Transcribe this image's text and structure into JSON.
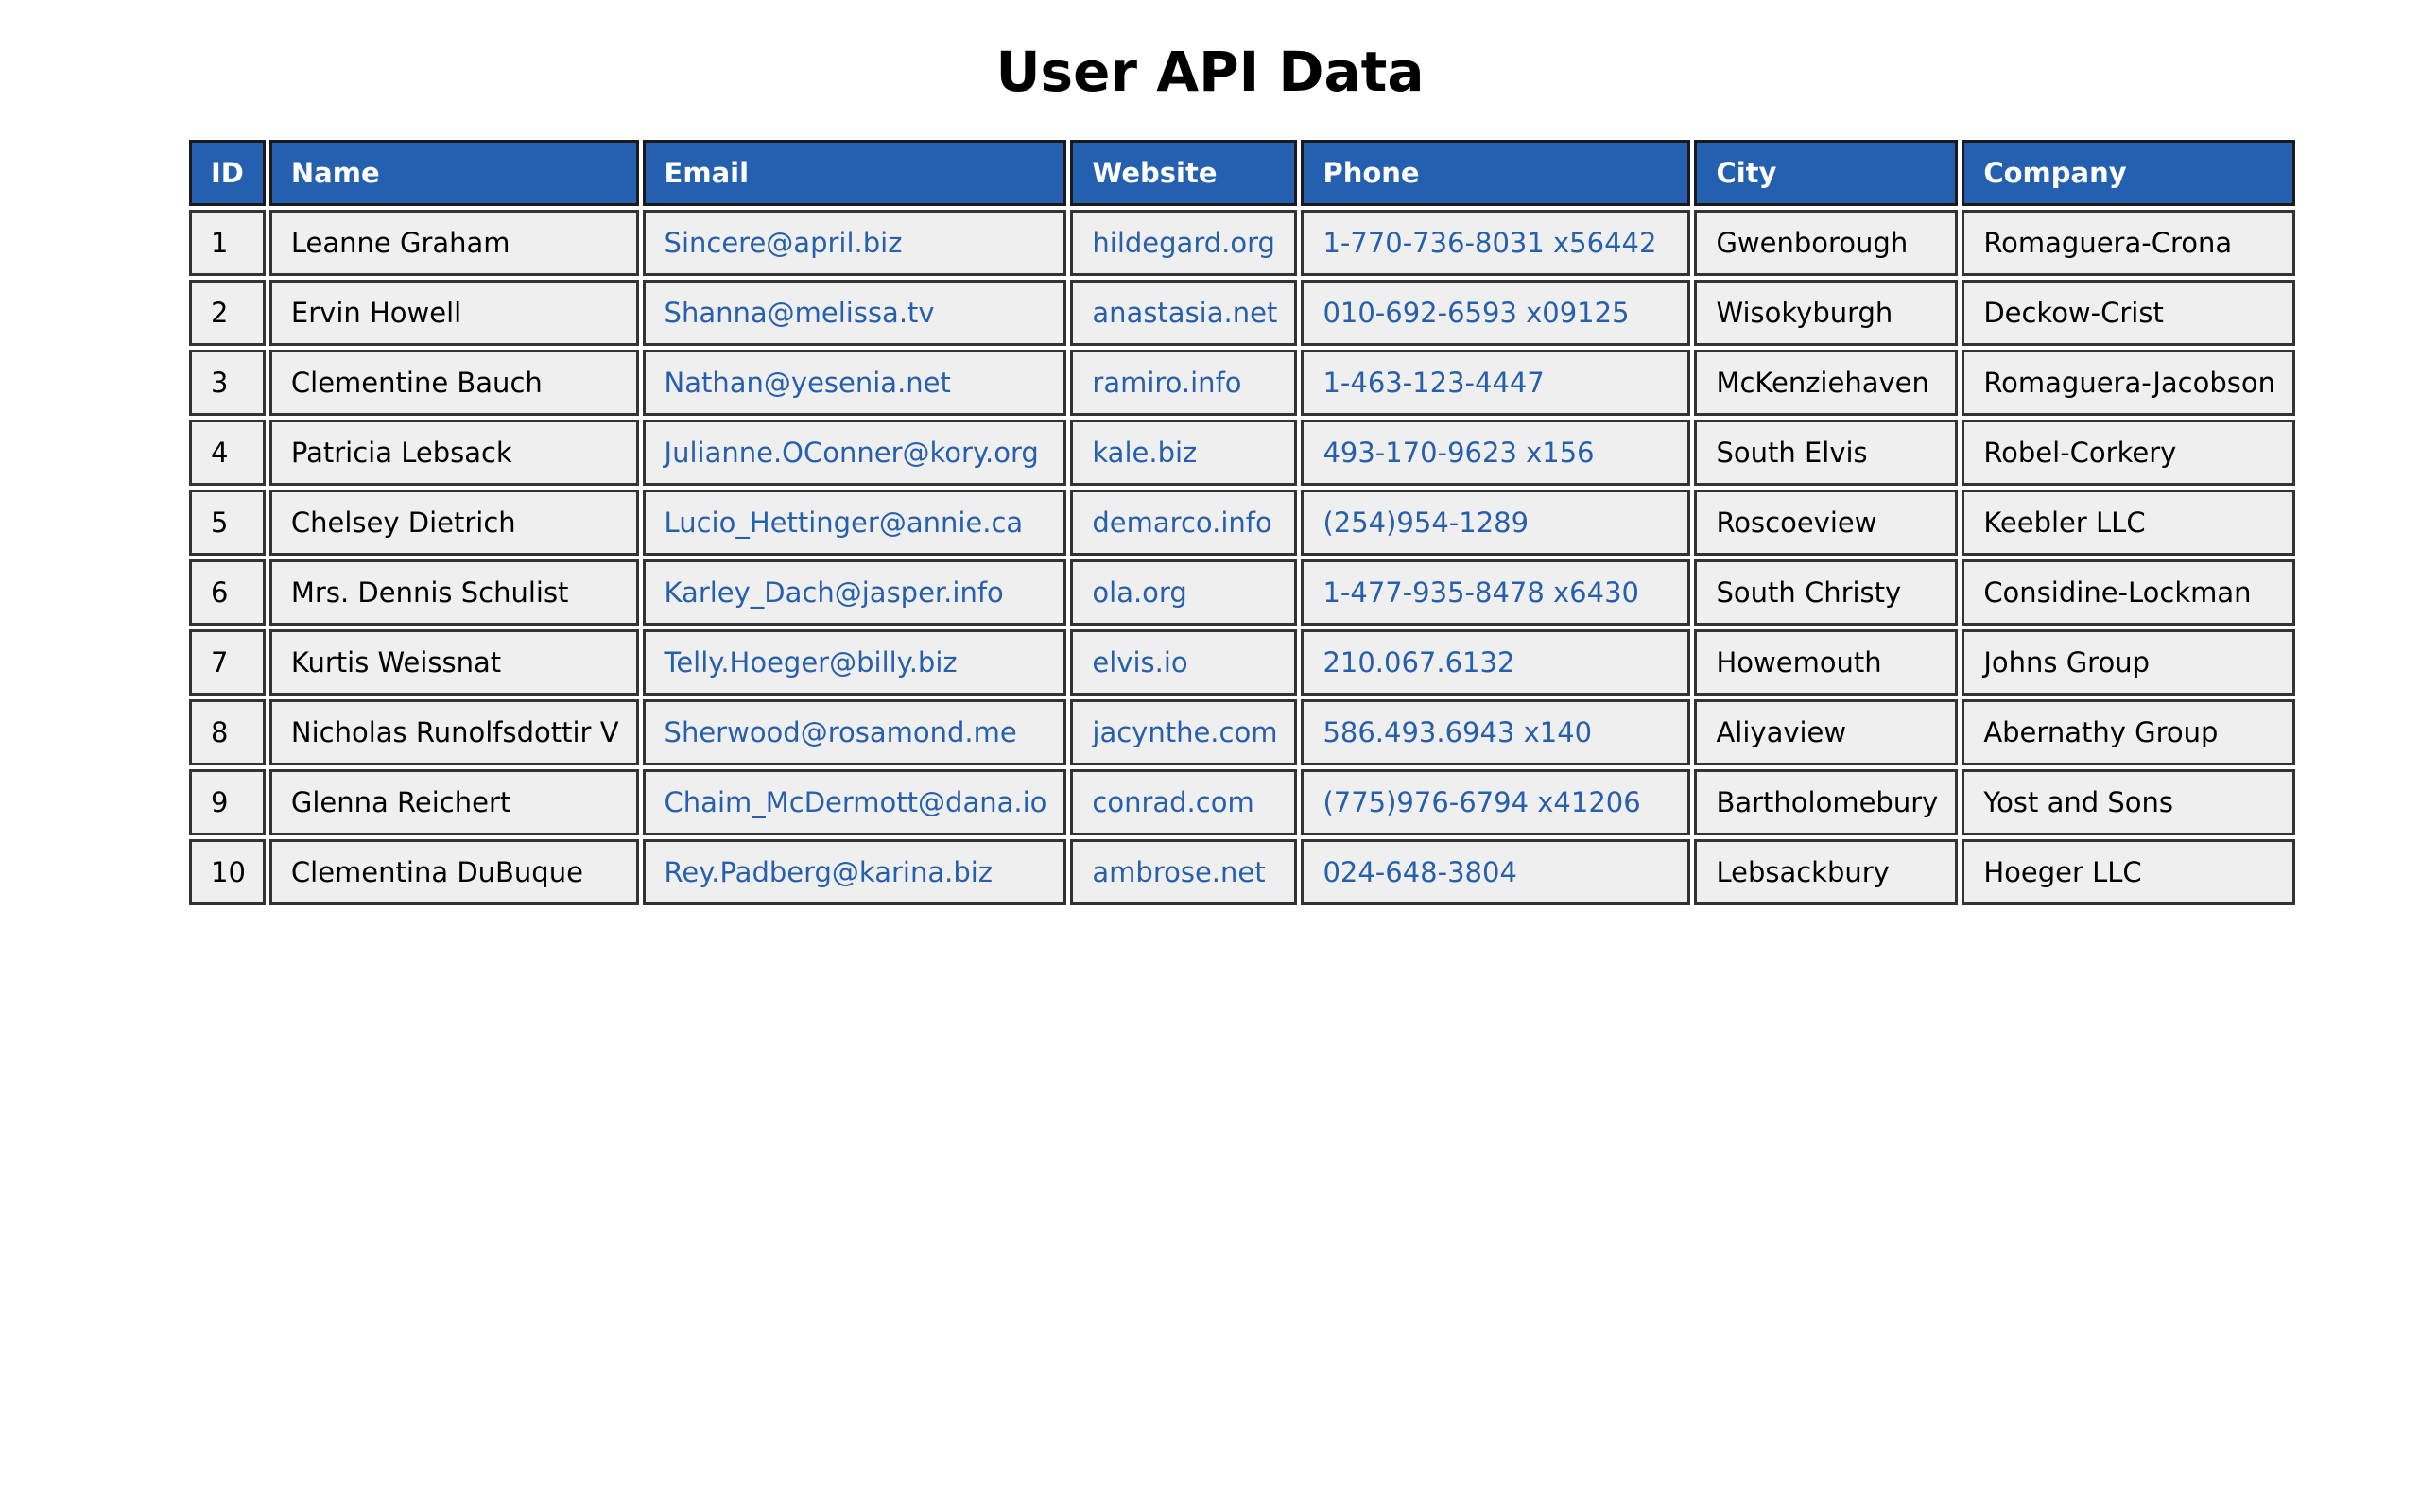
{
  "page": {
    "title": "User API Data"
  },
  "table": {
    "columns": [
      "ID",
      "Name",
      "Email",
      "Website",
      "Phone",
      "City",
      "Company"
    ],
    "rows": [
      [
        "1",
        "Leanne Graham",
        "Sincere@april.biz",
        "hildegard.org",
        "1-770-736-8031 x56442",
        "Gwenborough",
        "Romaguera-Crona"
      ],
      [
        "2",
        "Ervin Howell",
        "Shanna@melissa.tv",
        "anastasia.net",
        "010-692-6593 x09125",
        "Wisokyburgh",
        "Deckow-Crist"
      ],
      [
        "3",
        "Clementine Bauch",
        "Nathan@yesenia.net",
        "ramiro.info",
        "1-463-123-4447",
        "McKenziehaven",
        "Romaguera-Jacobson"
      ],
      [
        "4",
        "Patricia Lebsack",
        "Julianne.OConner@kory.org",
        "kale.biz",
        "493-170-9623 x156",
        "South Elvis",
        "Robel-Corkery"
      ],
      [
        "5",
        "Chelsey Dietrich",
        "Lucio_Hettinger@annie.ca",
        "demarco.info",
        "(254)954-1289",
        "Roscoeview",
        "Keebler LLC"
      ],
      [
        "6",
        "Mrs. Dennis Schulist",
        "Karley_Dach@jasper.info",
        "ola.org",
        "1-477-935-8478 x6430",
        "South Christy",
        "Considine-Lockman"
      ],
      [
        "7",
        "Kurtis Weissnat",
        "Telly.Hoeger@billy.biz",
        "elvis.io",
        "210.067.6132",
        "Howemouth",
        "Johns Group"
      ],
      [
        "8",
        "Nicholas Runolfsdottir V",
        "Sherwood@rosamond.me",
        "jacynthe.com",
        "586.493.6943 x140",
        "Aliyaview",
        "Abernathy Group"
      ],
      [
        "9",
        "Glenna Reichert",
        "Chaim_McDermott@dana.io",
        "conrad.com",
        "(775)976-6794 x41206",
        "Bartholomebury",
        "Yost and Sons"
      ],
      [
        "10",
        "Clementina DuBuque",
        "Rey.Padberg@karina.biz",
        "ambrose.net",
        "024-648-3804",
        "Lebsackbury",
        "Hoeger LLC"
      ]
    ]
  },
  "colors": {
    "header_bg": "#2560b0",
    "header_text": "#ffffff",
    "cell_bg": "#f0eff0",
    "link_text": "#2660ad",
    "border": "#333333"
  }
}
